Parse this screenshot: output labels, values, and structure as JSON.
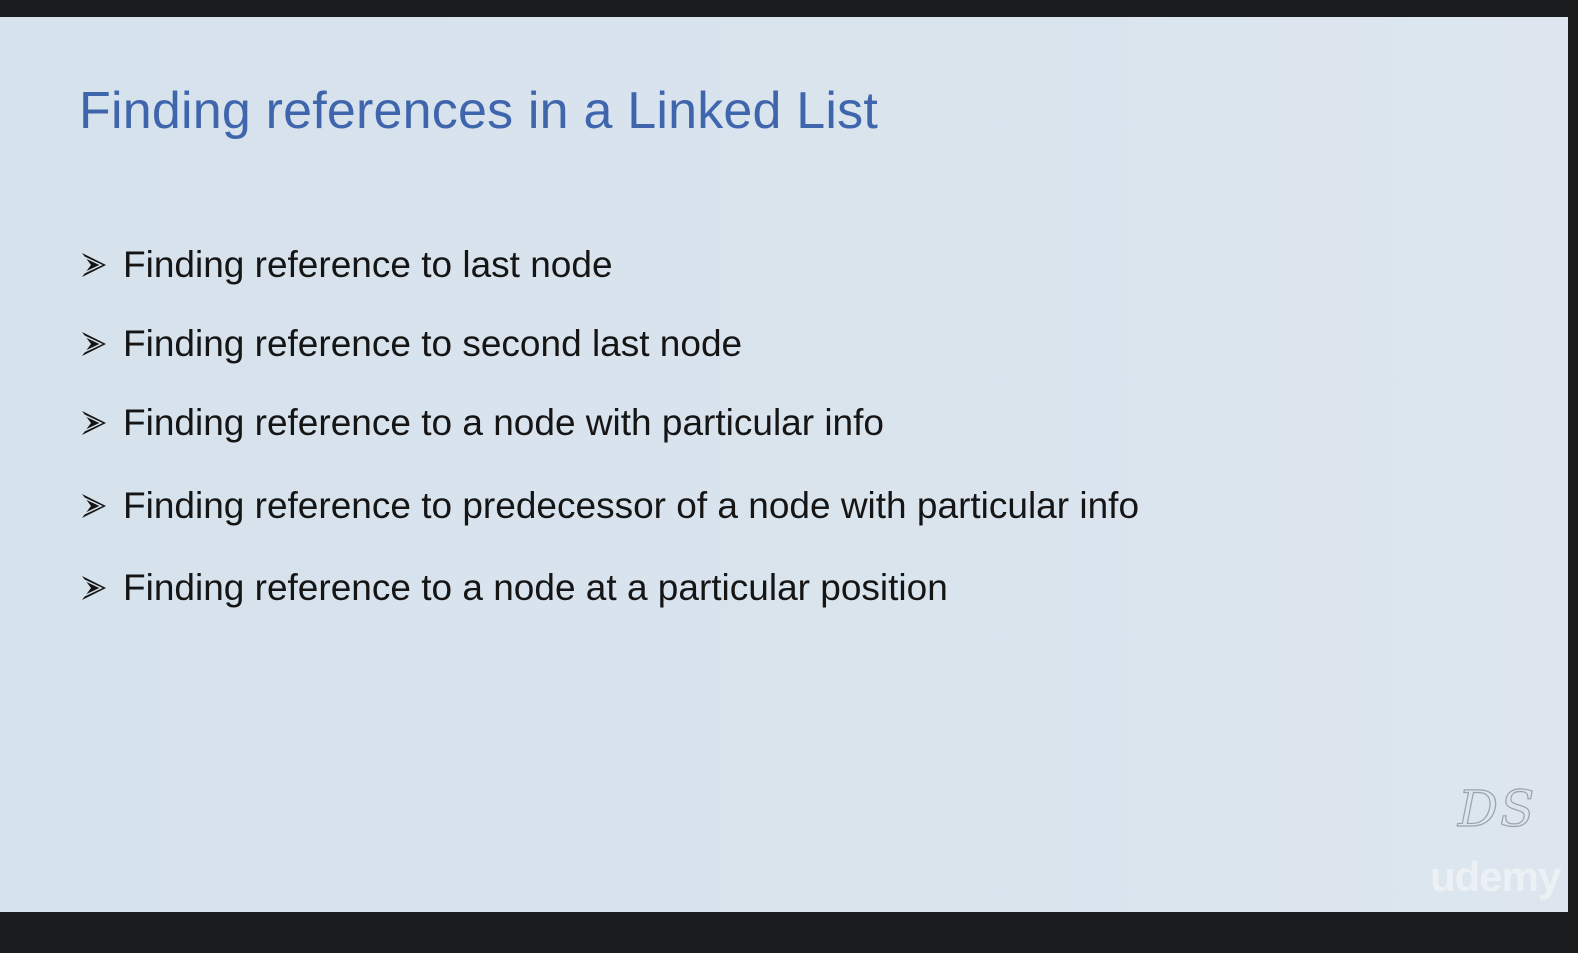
{
  "slide": {
    "title": "Finding references in a Linked List",
    "bullets": [
      "Finding reference to last node",
      "Finding reference to second last node",
      "Finding reference to a node with particular info",
      "Finding reference to predecessor of a node with particular info",
      "Finding reference to a node at a particular position"
    ],
    "bullet_icon": "arrowhead-bullet-icon",
    "logo_text": "DS",
    "watermark_text": "udemy"
  },
  "colors": {
    "title": "#3f65ad",
    "text": "#151515",
    "background": "#d8e3ed",
    "frame": "#1b1c1e"
  }
}
